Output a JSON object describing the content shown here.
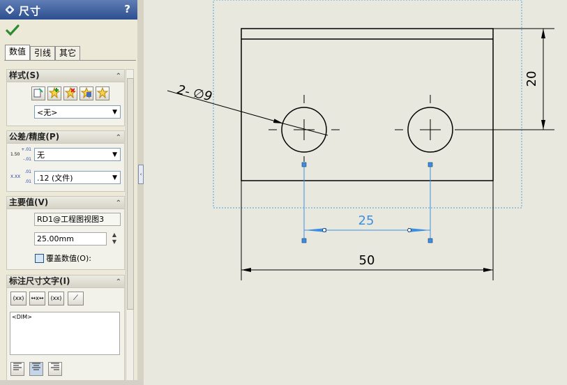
{
  "panel": {
    "title": "尺寸",
    "help": "?",
    "tabs": [
      "数值",
      "引线",
      "其它"
    ],
    "style_group": {
      "title": "样式(S)",
      "dropdown_value": "<无>"
    },
    "tolerance_group": {
      "title": "公差/精度(P)",
      "tolerance_icon_text": {
        "top": "+.01",
        "mid": "1.50",
        "bot": "-.01"
      },
      "precision_icon_text": {
        "top": ".01",
        "mid": "X.XX",
        "bot": ".01"
      },
      "tolerance_value": "无",
      "precision_value": ".12 (文件)"
    },
    "primary_group": {
      "title": "主要值(V)",
      "reference": "RD1@工程图视图3",
      "value": "25.00mm",
      "override_label": "覆盖数值(O):"
    },
    "dimtext_group": {
      "title": "标注尺寸文字(I)",
      "buttons": [
        "(xx)",
        "↔x↔",
        "(xx)",
        "⟋"
      ],
      "text": "<DIM>"
    }
  },
  "drawing": {
    "hole_callout": "2- ∅9",
    "dim_height": "20",
    "dim_hole_spacing": "25",
    "dim_width": "50"
  },
  "colors": {
    "title_bg": "#2d4f8f",
    "check_green": "#2e8b2e",
    "selected_dim": "#3c8fe0",
    "view_border": "#4aa3df"
  }
}
